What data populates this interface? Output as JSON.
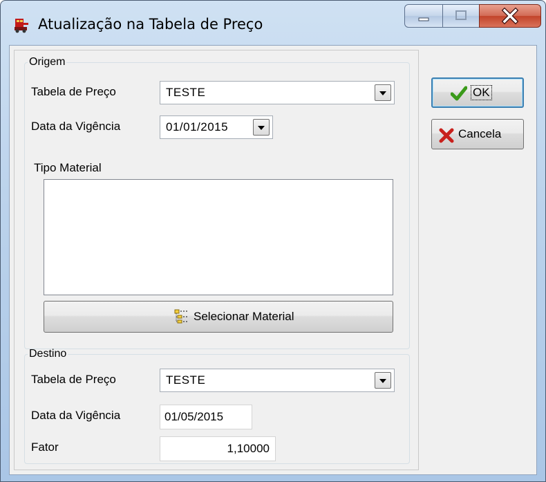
{
  "window": {
    "title": "Atualização na Tabela de Preço"
  },
  "origem": {
    "legend": "Origem",
    "tabela_label": "Tabela de Preço",
    "tabela_value": "TESTE",
    "data_label": "Data da Vigência",
    "data_value": "01/01/2015",
    "tipo_material_label": "Tipo Material",
    "tipo_material_items": [],
    "selecionar_button": "Selecionar Material"
  },
  "destino": {
    "legend": "Destino",
    "tabela_label": "Tabela de Preço",
    "tabela_value": "TESTE",
    "data_label": "Data da Vigência",
    "data_value": "01/05/2015",
    "fator_label": "Fator",
    "fator_value": "1,10000"
  },
  "buttons": {
    "ok": "OK",
    "cancela": "Cancela"
  },
  "colors": {
    "ok_check": "#3a9a1a",
    "cancel_x": "#c8201c"
  },
  "icons": [
    "app-icon",
    "minimize-icon",
    "maximize-icon",
    "close-icon",
    "dropdown-arrow-icon",
    "tree-icon",
    "checkmark-icon",
    "x-cancel-icon"
  ]
}
